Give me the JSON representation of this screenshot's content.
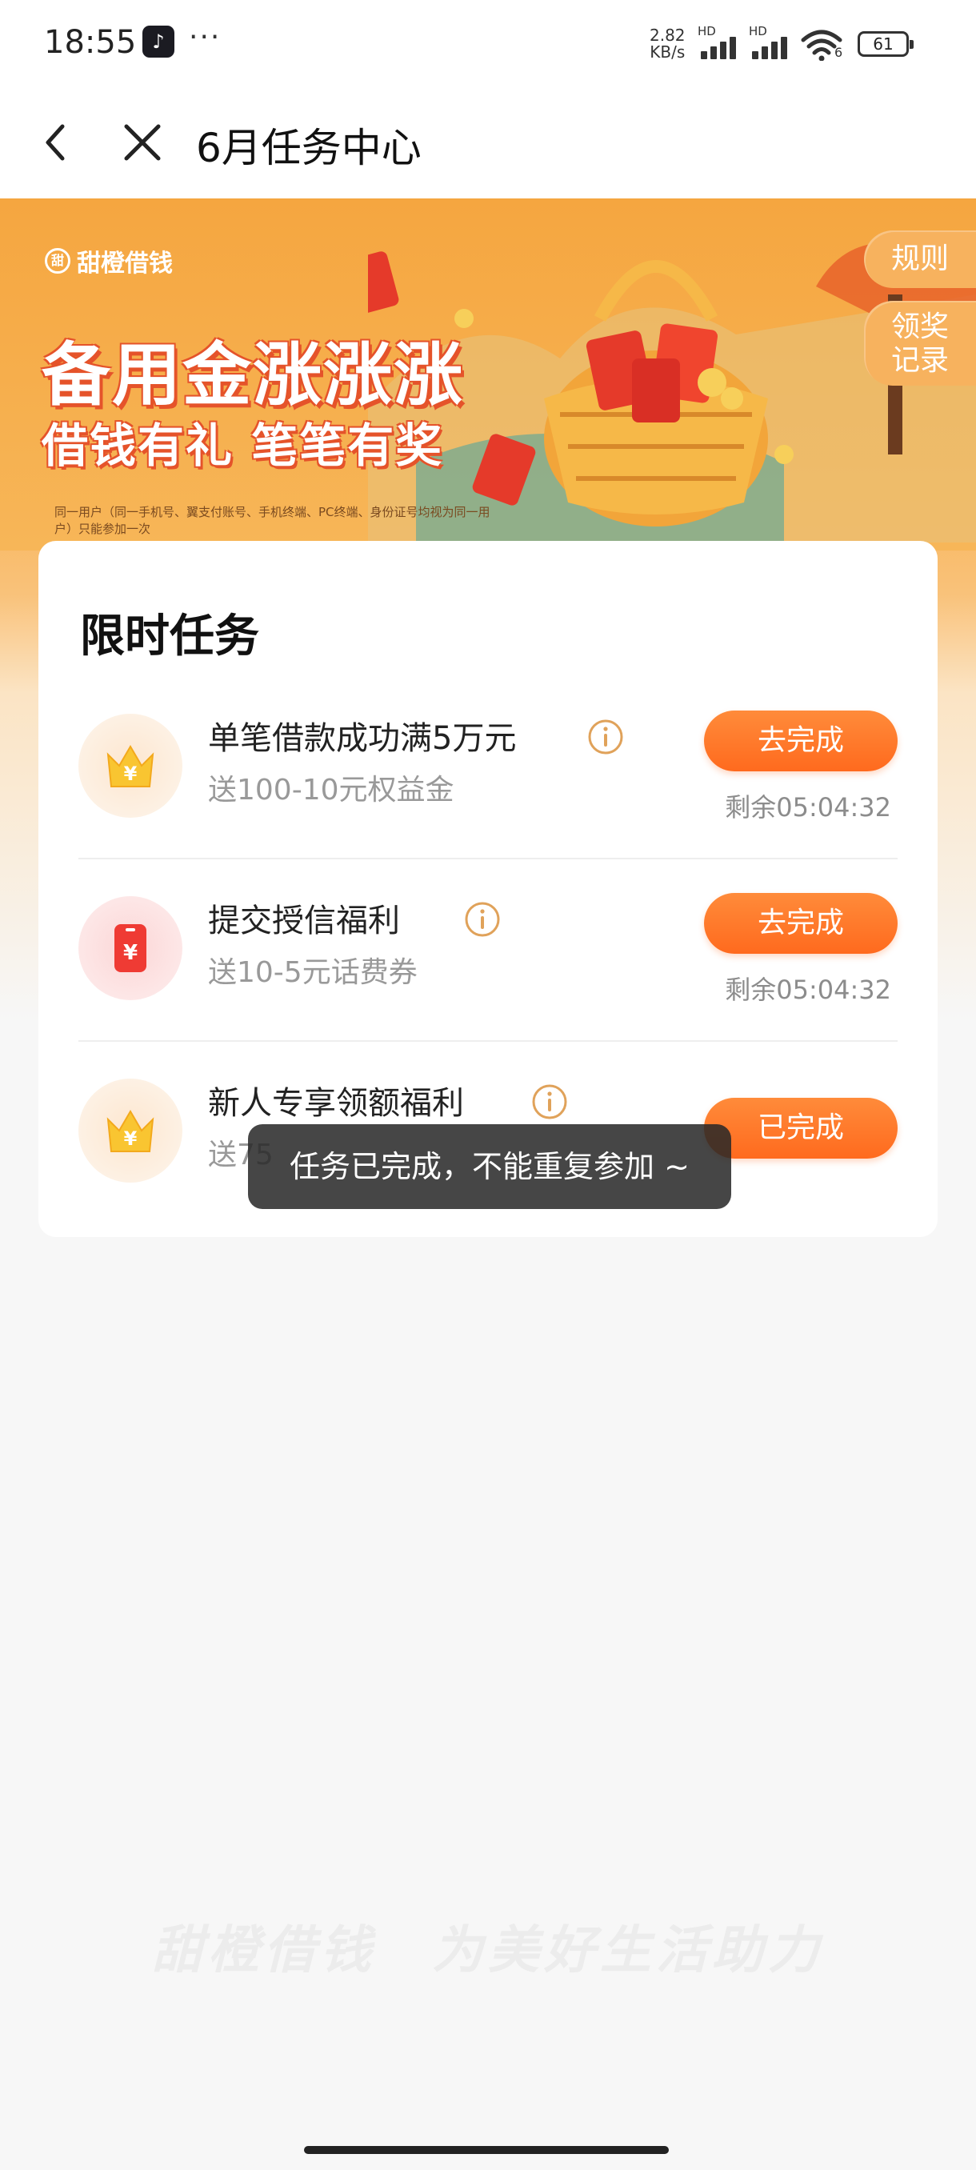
{
  "status_bar": {
    "time": "18:55",
    "dots": "···",
    "speed_value": "2.82",
    "speed_unit": "KB/s",
    "hd_label": "HD",
    "wifi_number": "6",
    "battery": "61"
  },
  "nav": {
    "title": "6月任务中心"
  },
  "banner": {
    "brand": "甜橙借钱",
    "headline": "备用金涨涨涨",
    "subline": "借钱有礼 笔笔有奖",
    "disclaimer": "同一用户（同一手机号、翼支付账号、手机终端、PC终端、身份证号均视为同一用户）只能参加一次",
    "rules_label": "规则",
    "records_line1": "领奖",
    "records_line2": "记录"
  },
  "card": {
    "title": "限时任务",
    "tasks": [
      {
        "name": "单笔借款成功满5万元",
        "desc": "送100-10元权益金",
        "button": "去完成",
        "remaining": "剩余05:04:32",
        "icon": "crown-yuan-icon"
      },
      {
        "name": "提交授信福利",
        "desc": "送10-5元话费券",
        "button": "去完成",
        "remaining": "剩余05:04:32",
        "icon": "red-phone-yuan-icon"
      },
      {
        "name": "新人专享领额福利",
        "desc": "送75",
        "button": "已完成",
        "remaining": "",
        "icon": "crown-yuan-icon"
      }
    ]
  },
  "toast": {
    "text": "任务已完成，不能重复参加 ~"
  },
  "footer": {
    "slogan": "甜橙借钱　为美好生活助力"
  },
  "colors": {
    "accent": "#ff6a1e",
    "banner": "#f6a744",
    "info_icon": "#e0a25a"
  }
}
